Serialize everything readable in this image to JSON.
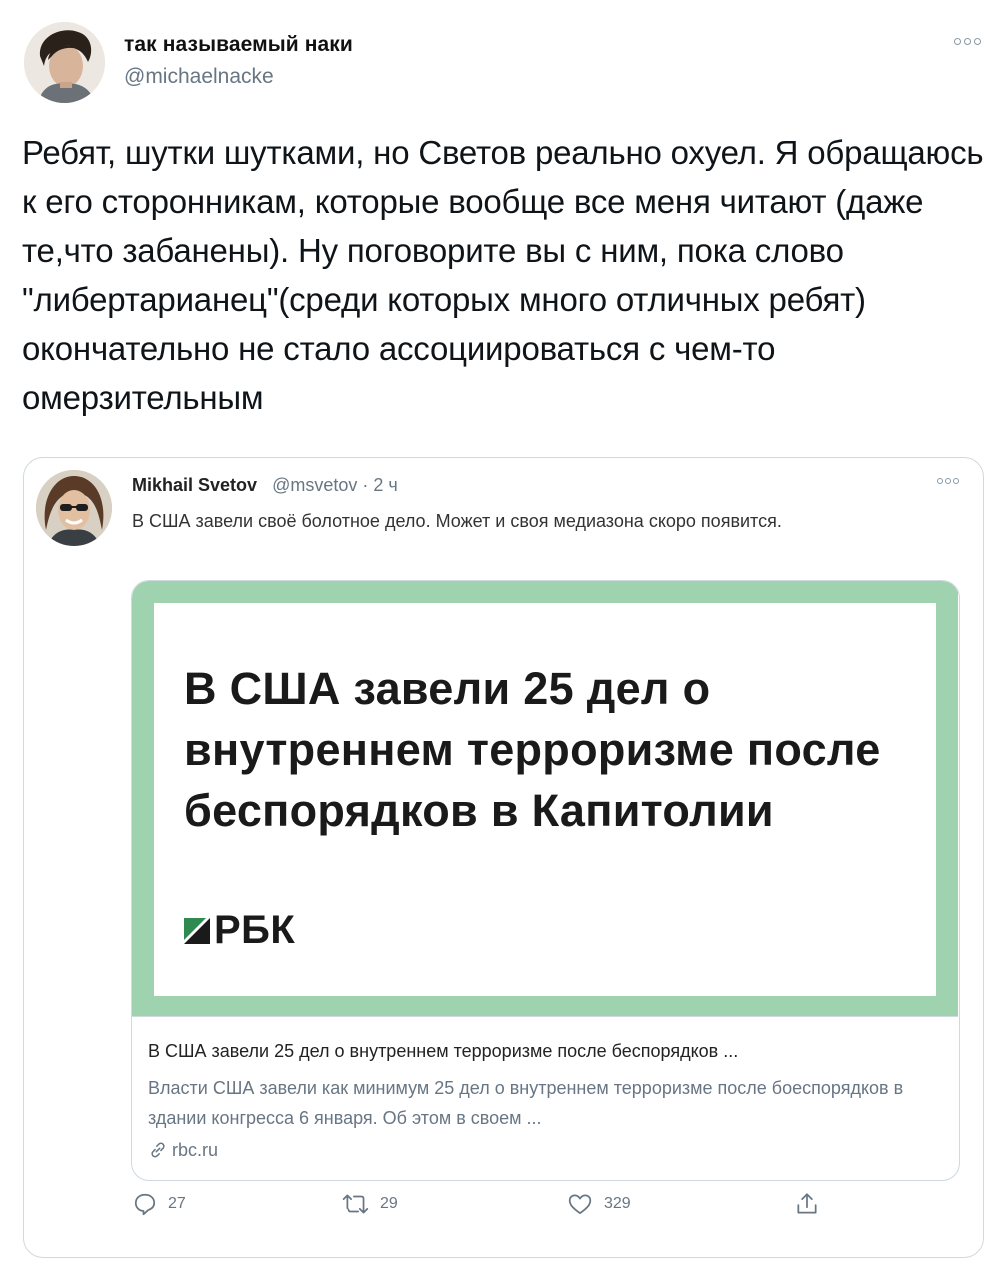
{
  "author": {
    "display_name": "так называемый наки",
    "handle": "@michaelnacke"
  },
  "tweet": {
    "text": "Ребят, шутки шутками, но Светов реально охуел. Я обращаюсь к его сторонникам, которые вообще все меня читают (даже те,что забанены). Ну поговорите вы с ним, пока слово \"либертарианец\"(среди которых много отличных ребят) окончательно не стало ассоциироваться с чем-то омерзительным"
  },
  "quoted_tweet": {
    "author_name": "Mikhail Svetov",
    "handle": "@msvetov",
    "separator": " · ",
    "time": "2 ч",
    "text": "В США завели своё болотное дело. Может и своя медиазона скоро появится.",
    "link_card": {
      "headline": "В США завели 25 дел о внутреннем терроризме после беспорядков в Капитолии",
      "logo": "РБК",
      "title": "В США завели 25 дел о внутреннем терроризме после беспорядков ...",
      "description": "Власти США завели как минимум 25 дел о внутреннем терроризме после боеспорядков в здании конгресса 6 января. Об этом в своем ...",
      "domain": "rbc.ru"
    }
  },
  "actions": {
    "replies": "27",
    "retweets": "29",
    "likes": "329"
  },
  "colors": {
    "card_border": "#cfd9de",
    "rbc_green": "#9fd3b0",
    "secondary_text": "#687684"
  },
  "icons": [
    "more-icon",
    "reply-icon",
    "retweet-icon",
    "like-icon",
    "share-icon",
    "link-icon",
    "rbc-logo-icon"
  ]
}
